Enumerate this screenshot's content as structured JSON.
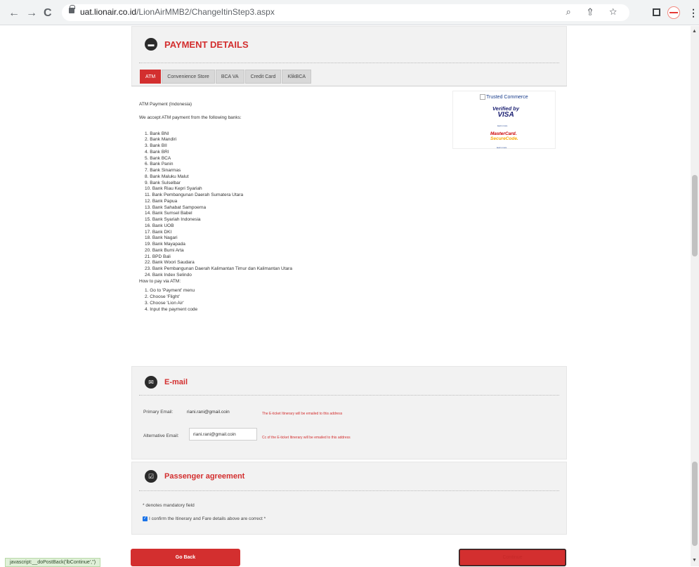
{
  "browser": {
    "url_host": "uat.lionair.co.id",
    "url_path": "/LionAirMMB2/ChangeItinStep3.aspx",
    "back_glyph": "←",
    "forward_glyph": "→",
    "reload_glyph": "C",
    "omnibox_icons": "⌕ ⇪ ☆",
    "icons": [
      "lock-icon",
      "zoom-icon",
      "share-icon",
      "bookmark-star-icon",
      "window-icon",
      "profile-icon",
      "menu-dots-icon"
    ]
  },
  "payment": {
    "title": "PAYMENT DETAILS",
    "icon": "card-icon",
    "tabs": [
      {
        "label": "ATM",
        "active": true
      },
      {
        "label": "Convenience Store",
        "active": false
      },
      {
        "label": "BCA VA",
        "active": false
      },
      {
        "label": "Credit Card",
        "active": false
      },
      {
        "label": "KlikBCA",
        "active": false
      }
    ],
    "atm": {
      "heading": "ATM Payment (Indonesia)",
      "intro": "We accept ATM payment from the following banks:",
      "banks": [
        "1. Bank BNI",
        "2. Bank Mandiri",
        "3. Bank BII",
        "4. Bank BRI",
        "5. Bank BCA",
        "6. Bank Panin",
        "7. Bank Sinarmas",
        "8. Bank Maluku Malut",
        "9. Bank Sulselbar",
        "10. Bank Riau Kepri Syariah",
        "11. Bank Pembangunan Daerah Sumatera Utara",
        "12. Bank Papua",
        "13. Bank Sahabat Sampoerna",
        "14. Bank Sumsel Babel",
        "15. Bank Syariah Indonesia",
        "16. Bank UOB",
        "17. Bank DKI",
        "18. Bank Nagari",
        "19. Bank Mayapada",
        "20. Bank Bumi Arta",
        "21. BPD Bali",
        "22. Bank Woori Saudara",
        "23. Bank Pembangunan Daerah Kalimantan Timur dan Kalimantan Utara",
        "24. Bank Index Selindo"
      ],
      "how_to": "How to pay via ATM:",
      "steps": [
        "1. Go to 'Payment' menu",
        "2. Choose 'Flight'",
        "3. Choose 'Lion Air'",
        "4. Input the payment code"
      ]
    },
    "trusted": {
      "alt_text": "Trusted Commerce",
      "vbv_line1": "Verified by",
      "vbv_line2": "VISA",
      "learn_more": "learn more",
      "mc_line1": "MasterCard.",
      "mc_line2": "SecureCode.",
      "mc_learn_more": "learn more"
    }
  },
  "email": {
    "title": "E-mail",
    "icon": "envelope-icon",
    "primary_label": "Primary Email:",
    "primary_value": "riani.rani@gmail.coin",
    "primary_note": "The E-ticket Itinerary will be emailed to this address",
    "alt_label": "Alternative Email:",
    "alt_value": "riani.rani@gmail.coin",
    "alt_note": "Cc of the E-ticket Itinerary will be emailed to this address"
  },
  "agreement": {
    "title": "Passenger agreement",
    "icon": "clipboard-check-icon",
    "mandatory_note": "* denotes mandatory field",
    "confirm_text": "I confirm the Itinerary and Fare details above are correct *",
    "checked": true
  },
  "buttons": {
    "back": "Go Back",
    "continue": "Continue"
  },
  "status_bar": "javascript:__doPostBack('lbContinue','')"
}
